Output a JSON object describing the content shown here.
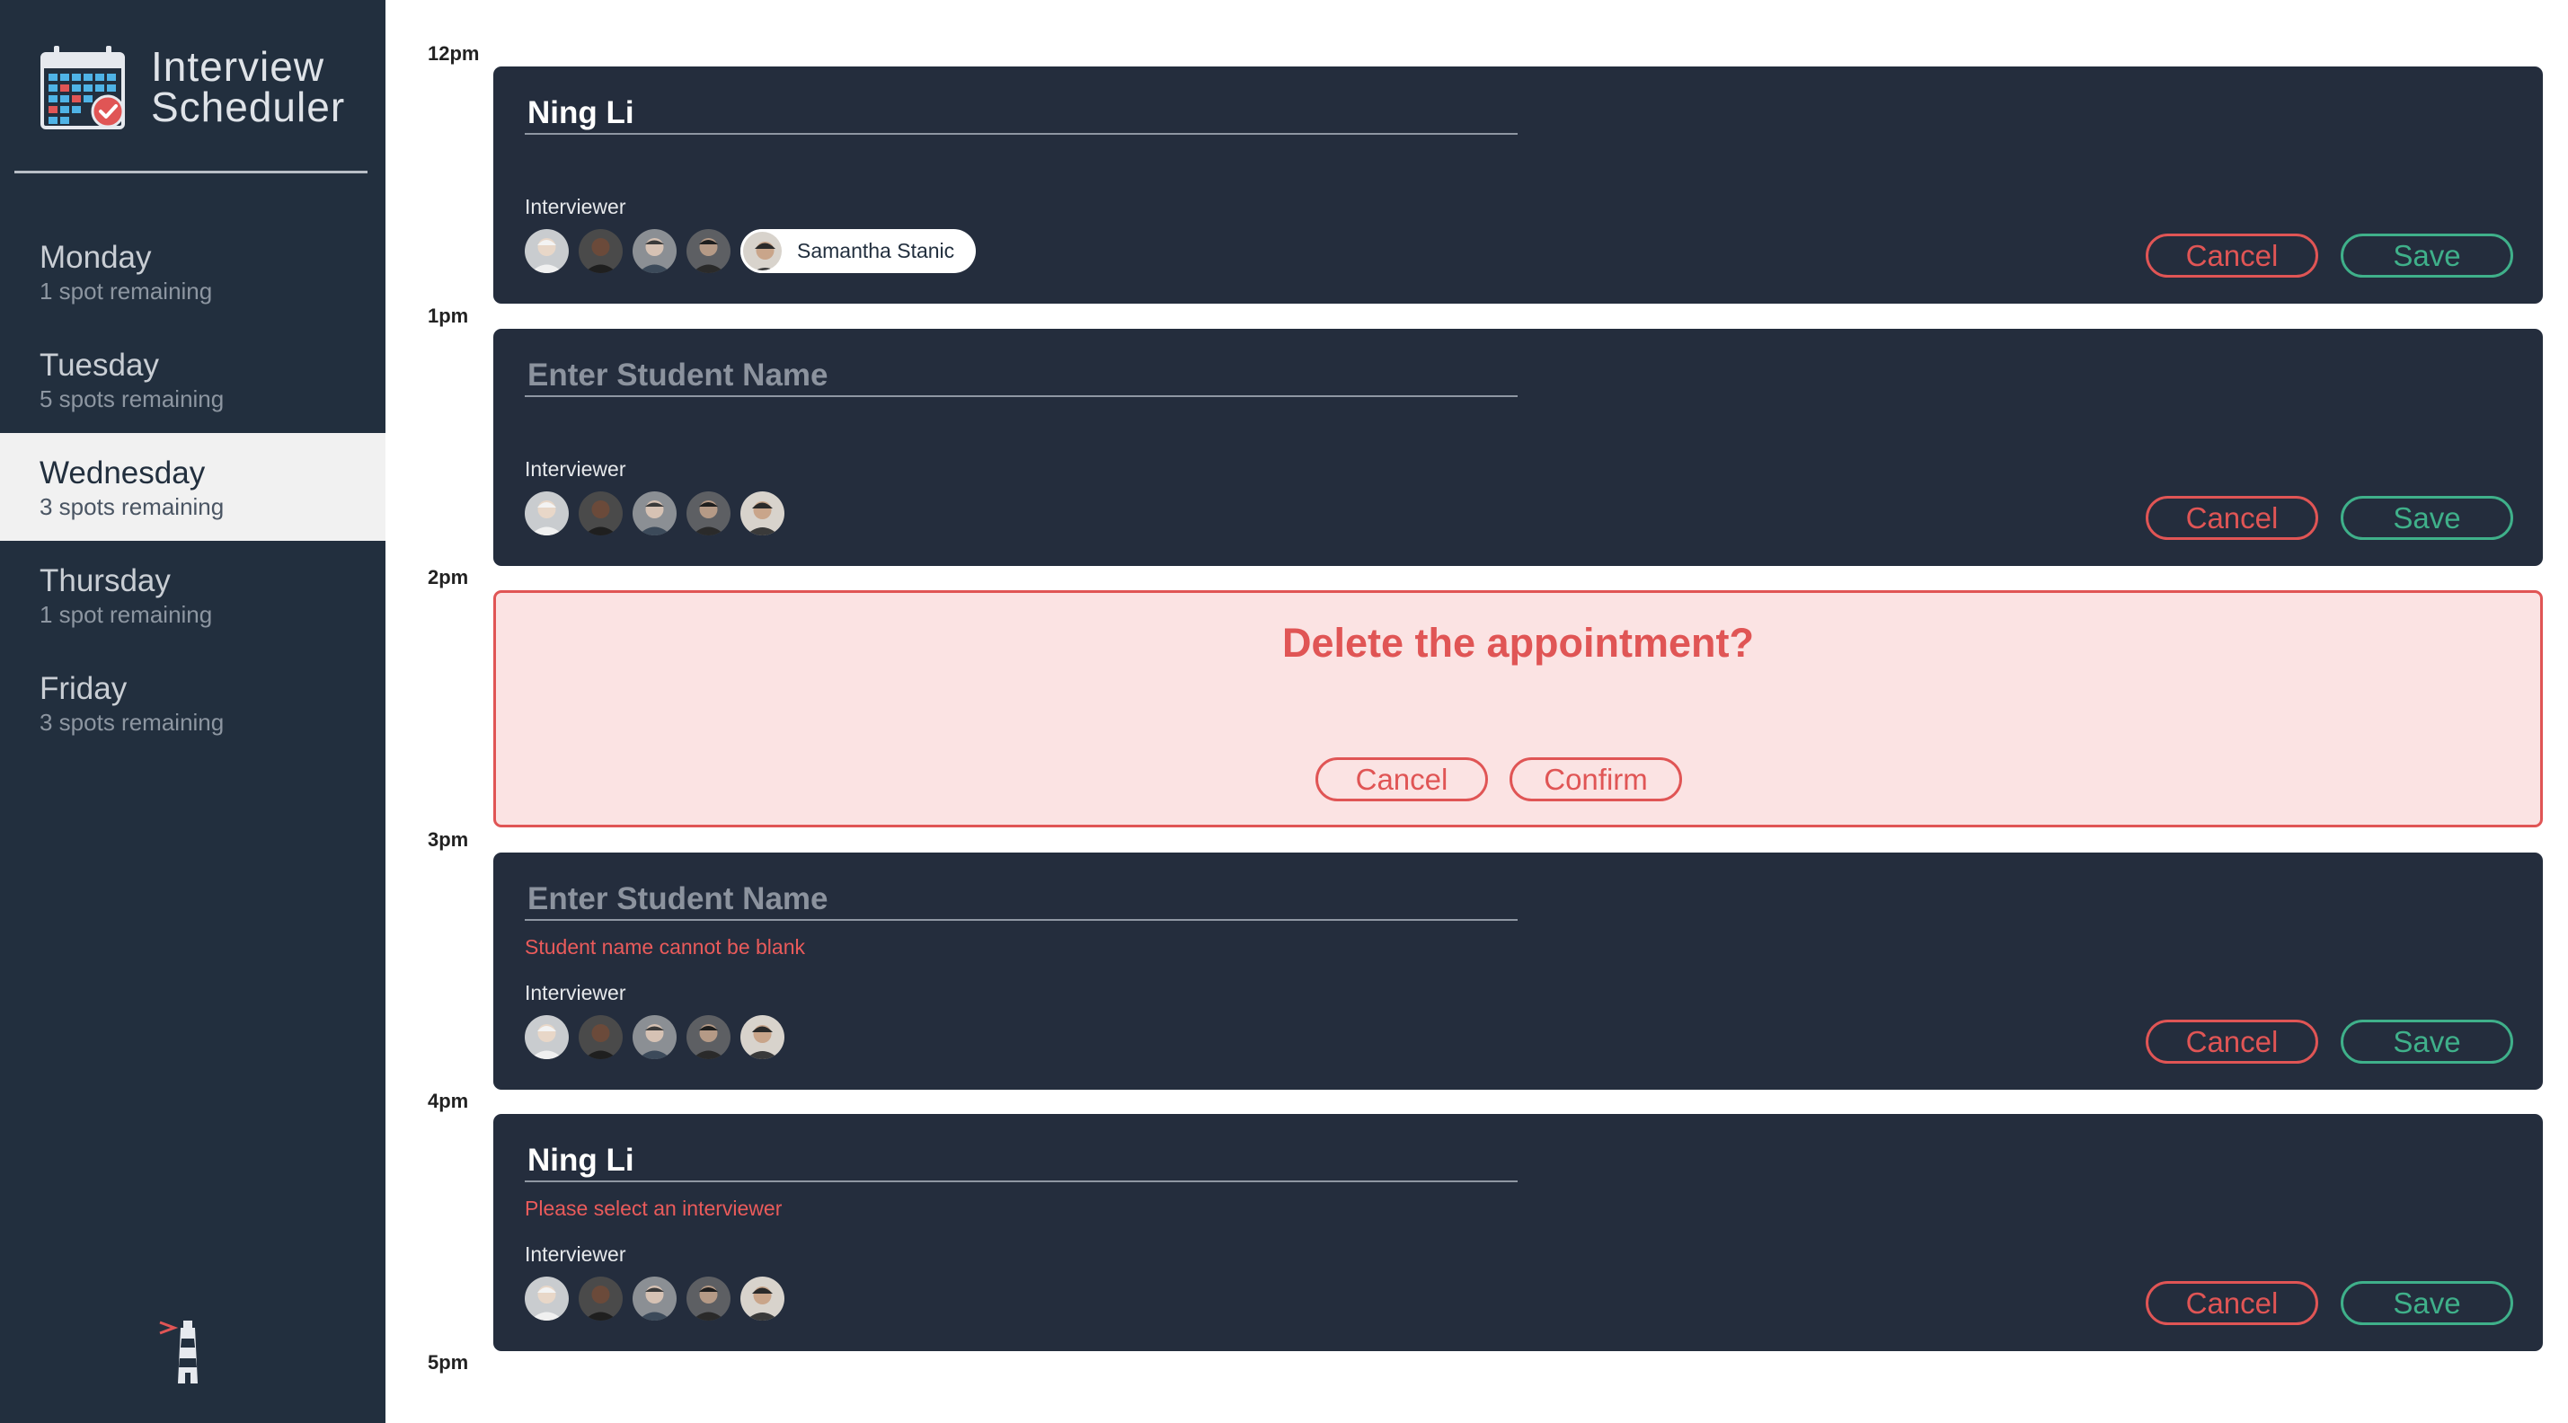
{
  "app": {
    "title_line1": "Interview",
    "title_line2": "Scheduler"
  },
  "sidebar": {
    "days": [
      {
        "name": "Monday",
        "spots": "1 spot remaining",
        "selected": false
      },
      {
        "name": "Tuesday",
        "spots": "5 spots remaining",
        "selected": false
      },
      {
        "name": "Wednesday",
        "spots": "3 spots remaining",
        "selected": true
      },
      {
        "name": "Thursday",
        "spots": "1 spot remaining",
        "selected": false
      },
      {
        "name": "Friday",
        "spots": "3 spots remaining",
        "selected": false
      }
    ]
  },
  "times": [
    "12pm",
    "1pm",
    "2pm",
    "3pm",
    "4pm",
    "5pm"
  ],
  "appointments": [
    {
      "student_name": "Ning Li",
      "placeholder": "",
      "error": "",
      "interviewer_label": "Interviewer",
      "selected_interviewer": "Samantha Stanic",
      "cancel_label": "Cancel",
      "save_label": "Save"
    },
    {
      "student_name": "",
      "placeholder": "Enter Student Name",
      "error": "",
      "interviewer_label": "Interviewer",
      "selected_interviewer": "",
      "cancel_label": "Cancel",
      "save_label": "Save"
    },
    {
      "confirm_message": "Delete the appointment?",
      "cancel_label": "Cancel",
      "confirm_label": "Confirm"
    },
    {
      "student_name": "",
      "placeholder": "Enter Student Name",
      "error": "Student name cannot be blank",
      "interviewer_label": "Interviewer",
      "selected_interviewer": "",
      "cancel_label": "Cancel",
      "save_label": "Save"
    },
    {
      "student_name": "Ning Li",
      "placeholder": "",
      "error": "Please select an interviewer",
      "interviewer_label": "Interviewer",
      "selected_interviewer": "",
      "cancel_label": "Cancel",
      "save_label": "Save"
    }
  ],
  "colors": {
    "sidebar_bg": "#222f3e",
    "card_bg": "#242d3d",
    "danger": "#e05555",
    "success": "#3fb08a",
    "confirm_bg": "#fbe3e3"
  }
}
